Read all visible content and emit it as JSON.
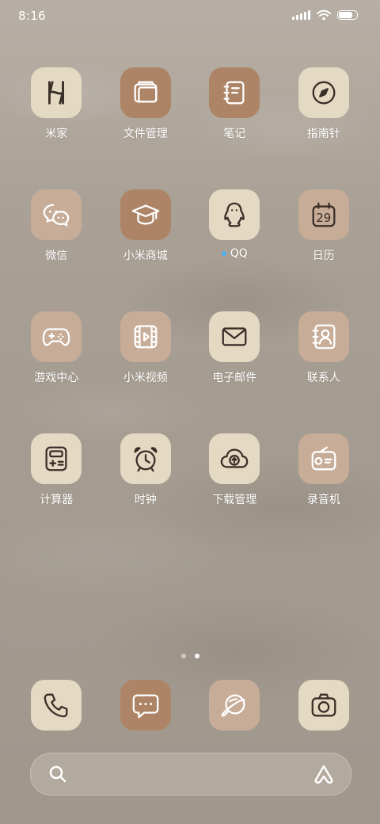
{
  "status_bar": {
    "time": "8:16",
    "battery_percent": 70
  },
  "apps": [
    {
      "label": "米家",
      "icon": "mijia-icon"
    },
    {
      "label": "文件管理",
      "icon": "folder-icon"
    },
    {
      "label": "笔记",
      "icon": "notebook-icon"
    },
    {
      "label": "指南针",
      "icon": "compass-icon"
    },
    {
      "label": "微信",
      "icon": "wechat-icon"
    },
    {
      "label": "小米商城",
      "icon": "graduation-cap-icon"
    },
    {
      "label": "QQ",
      "icon": "qq-penguin-icon",
      "has_new_dot": true
    },
    {
      "label": "日历",
      "icon": "calendar-icon",
      "calendar_day": "29"
    },
    {
      "label": "游戏中心",
      "icon": "gamepad-icon"
    },
    {
      "label": "小米视频",
      "icon": "video-icon"
    },
    {
      "label": "电子邮件",
      "icon": "mail-icon"
    },
    {
      "label": "联系人",
      "icon": "contacts-icon"
    },
    {
      "label": "计算器",
      "icon": "calculator-icon"
    },
    {
      "label": "时钟",
      "icon": "alarm-clock-icon"
    },
    {
      "label": "下载管理",
      "icon": "cloud-download-icon"
    },
    {
      "label": "录音机",
      "icon": "recorder-icon"
    }
  ],
  "page_indicator": {
    "total": 2,
    "current": 2
  },
  "dock": [
    {
      "name": "phone",
      "icon": "phone-icon"
    },
    {
      "name": "messages",
      "icon": "message-icon"
    },
    {
      "name": "browser",
      "icon": "browser-icon"
    },
    {
      "name": "camera",
      "icon": "camera-icon"
    }
  ],
  "search": {
    "icon": "search-icon",
    "assistant_icon": "assistant-icon"
  },
  "colors": {
    "icon_light": "#e4d9c2",
    "icon_mid": "#c7ac97",
    "icon_dark": "#ad8566",
    "icon_stroke": "#3a2f28",
    "qq_dot": "#4fb0ee"
  }
}
